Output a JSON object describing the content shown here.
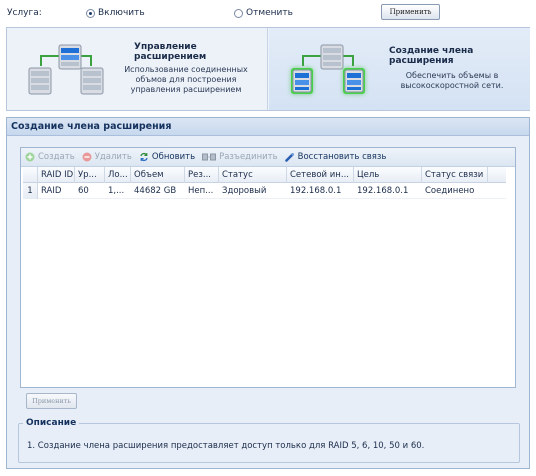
{
  "service": {
    "label": "Услуга:",
    "options": [
      {
        "label": "Включить",
        "checked": true
      },
      {
        "label": "Отменить",
        "checked": false
      }
    ],
    "apply_label": "Применить"
  },
  "banner": {
    "manage": {
      "title": "Управление расширением",
      "desc_lines": [
        "Использование соединенных",
        "объмов для построения",
        "управления расширением"
      ]
    },
    "create": {
      "title": "Создание члена расширения",
      "desc_lines": [
        "Обеспечить объемы в",
        "высокоскоростной сети."
      ]
    }
  },
  "main": {
    "title": "Создание члена расширения",
    "toolbar": [
      {
        "label": "Создать",
        "icon": "plus-circle-icon",
        "enabled": false
      },
      {
        "label": "Удалить",
        "icon": "minus-circle-icon",
        "enabled": false
      },
      {
        "label": "Обновить",
        "icon": "refresh-icon",
        "enabled": true
      },
      {
        "label": "Разъединить",
        "icon": "disconnect-icon",
        "enabled": false
      },
      {
        "label": "Восстановить связь",
        "icon": "reconnect-icon",
        "enabled": true
      }
    ],
    "columns": [
      "",
      "RAID ID",
      "Ур...",
      "Ло...",
      "Объем",
      "Рез...",
      "Статус",
      "Сетевой ин...",
      "Цель",
      "Статус связи"
    ],
    "rows": [
      [
        "1",
        "RAID",
        "60",
        "1,...",
        "44682 GB",
        "Неп...",
        "Здоровый",
        "192.168.0.1",
        "192.168.0.1",
        "Соединено"
      ]
    ],
    "apply_label": "Применить",
    "description": {
      "legend": "Описание",
      "text": "1. Создание члена расширения предоставляет доступ только для RAID 5, 6, 10, 50 и 60."
    }
  },
  "colors": {
    "accent": "#15325e",
    "panel_bg": "#e7eef8",
    "disabled_text": "#9aa6b6",
    "glow": "#46d24a"
  }
}
